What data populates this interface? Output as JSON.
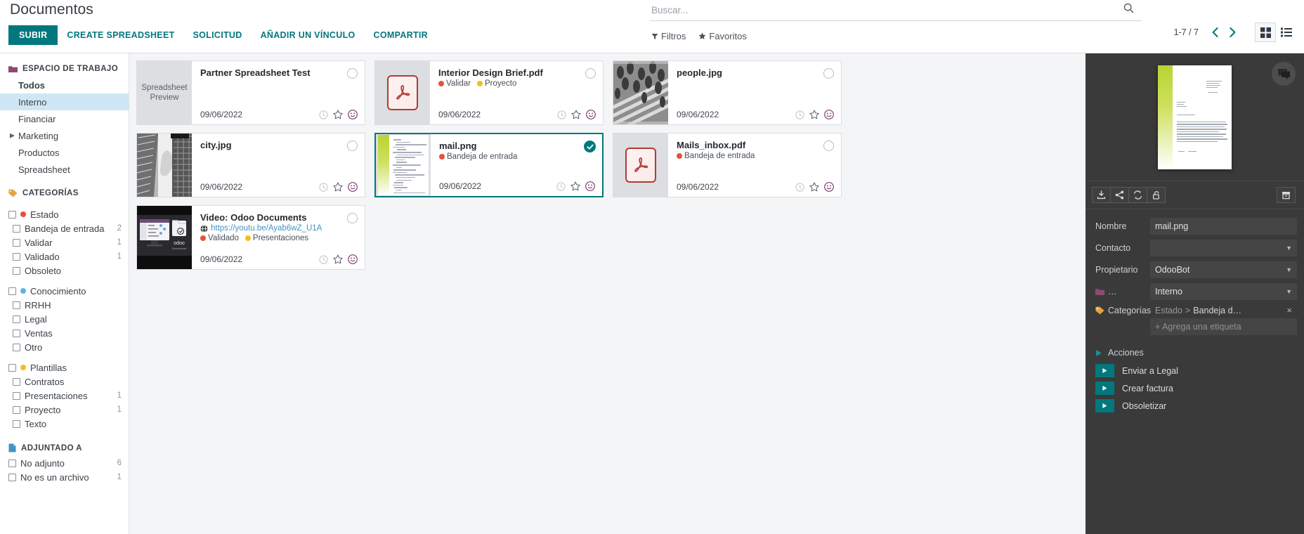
{
  "header": {
    "page_title": "Documentos",
    "buttons": [
      {
        "label": "SUBIR",
        "primary": true,
        "name": "upload-button"
      },
      {
        "label": "CREATE SPREADSHEET",
        "primary": false,
        "name": "create-spreadsheet-button"
      },
      {
        "label": "SOLICITUD",
        "primary": false,
        "name": "request-button"
      },
      {
        "label": "AÑADIR UN VÍNCULO",
        "primary": false,
        "name": "add-link-button"
      },
      {
        "label": "COMPARTIR",
        "primary": false,
        "name": "share-button"
      }
    ]
  },
  "search": {
    "placeholder": "Buscar...",
    "filters_label": "Filtros",
    "favorites_label": "Favoritos"
  },
  "pager": {
    "count": "1-7 / 7",
    "prev_label": "previous",
    "next_label": "next"
  },
  "view_switch": {
    "kanban_label": "Kanban",
    "list_label": "Lista",
    "active": "kanban"
  },
  "sidebar": {
    "workspace": {
      "title": "ESPACIO DE TRABAJO",
      "icon_color": "#8b4a72",
      "items": [
        {
          "label": "Todos",
          "bold": true,
          "active": false,
          "expandable": false
        },
        {
          "label": "Interno",
          "bold": false,
          "active": true,
          "expandable": false
        },
        {
          "label": "Financiar",
          "bold": false,
          "active": false,
          "expandable": false
        },
        {
          "label": "Marketing",
          "bold": false,
          "active": false,
          "expandable": true
        },
        {
          "label": "Productos",
          "bold": false,
          "active": false,
          "expandable": false
        },
        {
          "label": "Spreadsheet",
          "bold": false,
          "active": false,
          "expandable": false
        }
      ]
    },
    "categories": {
      "title": "CATEGORÍAS",
      "icon_color": "#e8a33d",
      "groups": [
        {
          "label": "Estado",
          "dot": "#e8503a",
          "count": "",
          "children": [
            {
              "label": "Bandeja de entrada",
              "count": "2"
            },
            {
              "label": "Validar",
              "count": "1"
            },
            {
              "label": "Validado",
              "count": "1"
            },
            {
              "label": "Obsoleto",
              "count": ""
            }
          ]
        },
        {
          "label": "Conocimiento",
          "dot": "#5db3e4",
          "count": "",
          "children": [
            {
              "label": "RRHH",
              "count": ""
            },
            {
              "label": "Legal",
              "count": ""
            },
            {
              "label": "Ventas",
              "count": ""
            },
            {
              "label": "Otro",
              "count": ""
            }
          ]
        },
        {
          "label": "Plantillas",
          "dot": "#f0c020",
          "count": "",
          "children": [
            {
              "label": "Contratos",
              "count": ""
            },
            {
              "label": "Presentaciones",
              "count": "1"
            },
            {
              "label": "Proyecto",
              "count": "1"
            },
            {
              "label": "Texto",
              "count": ""
            }
          ]
        }
      ]
    },
    "attached": {
      "title": "ADJUNTADO A",
      "icon_color": "#4393c4",
      "items": [
        {
          "label": "No adjunto",
          "count": "6"
        },
        {
          "label": "No es un archivo",
          "count": "1"
        }
      ]
    }
  },
  "kanban": {
    "cards": [
      {
        "title": "Partner Spreadsheet Test",
        "date": "09/06/2022",
        "thumb": "spreadsheet-preview",
        "thumb_text": "Spreadsheet Preview",
        "url": "",
        "tags": [],
        "selected": false
      },
      {
        "title": "Interior Design Brief.pdf",
        "date": "09/06/2022",
        "thumb": "pdf",
        "thumb_text": "",
        "url": "",
        "tags": [
          {
            "label": "Validar",
            "dot": "#e8503a"
          },
          {
            "label": "Proyecto",
            "dot": "#f0c020"
          }
        ],
        "selected": false
      },
      {
        "title": "people.jpg",
        "date": "09/06/2022",
        "thumb": "photo-people",
        "thumb_text": "",
        "url": "",
        "tags": [],
        "selected": false
      },
      {
        "title": "city.jpg",
        "date": "09/06/2022",
        "thumb": "photo-city",
        "thumb_text": "",
        "url": "",
        "tags": [],
        "selected": false
      },
      {
        "title": "mail.png",
        "date": "09/06/2022",
        "thumb": "mail-doc",
        "thumb_text": "",
        "url": "",
        "tags": [
          {
            "label": "Bandeja de entrada",
            "dot": "#e8503a"
          }
        ],
        "selected": true
      },
      {
        "title": "Mails_inbox.pdf",
        "date": "09/06/2022",
        "thumb": "pdf",
        "thumb_text": "",
        "url": "",
        "tags": [
          {
            "label": "Bandeja de entrada",
            "dot": "#e8503a"
          }
        ],
        "selected": false
      },
      {
        "title": "Video: Odoo Documents",
        "date": "09/06/2022",
        "thumb": "video",
        "thumb_text": "odoo",
        "url": "https://youtu.be/Ayab6wZ_U1A",
        "tags": [
          {
            "label": "Validado",
            "dot": "#e8503a"
          },
          {
            "label": "Presentaciones",
            "dot": "#f0c020"
          }
        ],
        "selected": false
      }
    ]
  },
  "right_panel": {
    "toolbar": [
      {
        "name": "download-icon",
        "label": "Descargar"
      },
      {
        "name": "share-icon",
        "label": "Compartir"
      },
      {
        "name": "replace-icon",
        "label": "Reemplazar"
      },
      {
        "name": "lock-icon",
        "label": "Bloquear"
      }
    ],
    "toolbar_right": {
      "name": "archive-icon",
      "label": "Archivar"
    },
    "chat_icon": "chat-icon",
    "fields": [
      {
        "label": "Nombre",
        "value": "mail.png",
        "type": "text",
        "name": "name-field"
      },
      {
        "label": "Contacto",
        "value": "",
        "type": "select",
        "name": "contact-field"
      },
      {
        "label": "Propietario",
        "value": "OdooBot",
        "type": "select",
        "name": "owner-field"
      },
      {
        "label": "…",
        "value": "Interno",
        "type": "select",
        "name": "workspace-field",
        "icon": "folder-icon"
      }
    ],
    "tags_field": {
      "label": "Categorías",
      "value_prefix": "Estado",
      "value_sep": ">",
      "value_main": "Bandeja d…",
      "remove_label": "×",
      "add_placeholder": "+ Agrega una etiqueta"
    },
    "actions": {
      "title": "Acciones",
      "items": [
        {
          "label": "Enviar a Legal"
        },
        {
          "label": "Crear factura"
        },
        {
          "label": "Obsoletizar"
        }
      ]
    }
  },
  "colors": {
    "accent": "#00787e",
    "selected_row": "#cfe7f5",
    "panel_bg": "#3a3a3a",
    "kanban_bg": "#f4f5f7"
  }
}
